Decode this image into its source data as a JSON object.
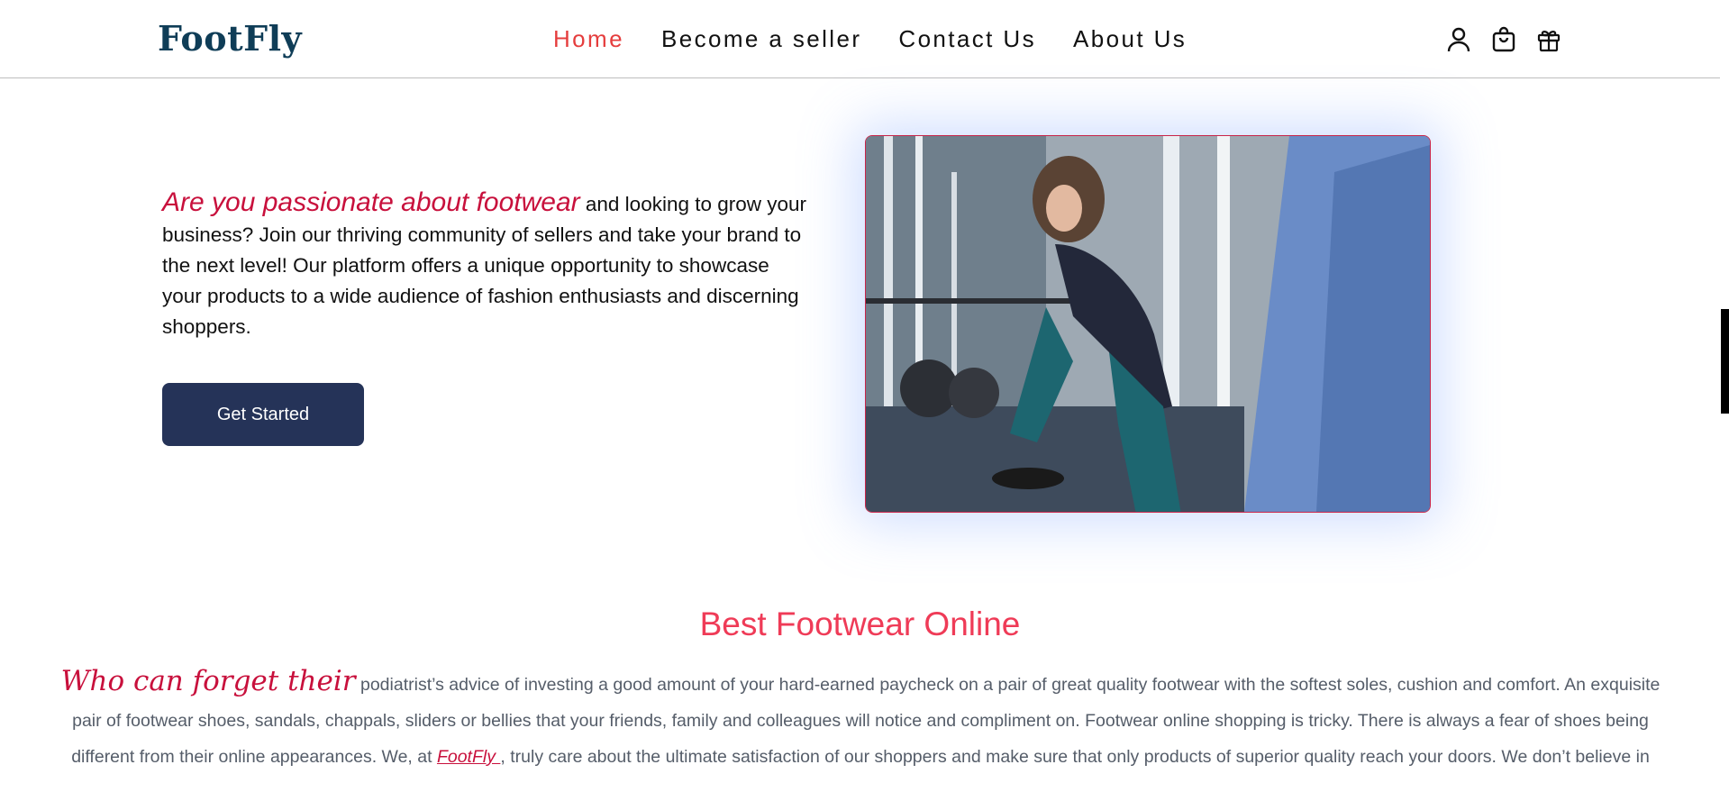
{
  "header": {
    "logo": "FootFly",
    "nav": [
      {
        "label": "Home",
        "active": true
      },
      {
        "label": "Become a seller",
        "active": false
      },
      {
        "label": "Contact Us",
        "active": false
      },
      {
        "label": "About Us",
        "active": false
      }
    ],
    "icons": [
      "user-icon",
      "shopping-bag-icon",
      "gift-icon"
    ]
  },
  "hero": {
    "highlight": "Are you passionate about footwear",
    "text": " and looking to grow your business? Join our thriving community of sellers and take your brand to the next level! Our platform offers a unique opportunity to showcase your products to a wide audience of fashion enthusiasts and discerning shoppers.",
    "cta_label": "Get Started"
  },
  "section": {
    "title": "Best Footwear Online",
    "lead": "Who can forget their",
    "body_1": " podiatrist’s advice of investing a good amount of your hard-earned paycheck on a pair of great quality footwear with the softest soles, cushion and comfort. An exquisite pair of footwear shoes, sandals, chappals, sliders or bellies that your friends, family and colleagues will notice and compliment on. Footwear online shopping is tricky. There is always a fear of shoes being different from their online appearances. We, at ",
    "brand": "FootFly ",
    "body_2": ", truly care about the ultimate satisfaction of our shoppers and make sure that only products of superior quality reach your doors. We don’t believe in"
  },
  "colors": {
    "accent_red": "#e53d3d",
    "brand_crimson": "#c8103c",
    "section_title": "#ef3b57",
    "button_navy": "#253358",
    "logo": "#0f3d57"
  }
}
